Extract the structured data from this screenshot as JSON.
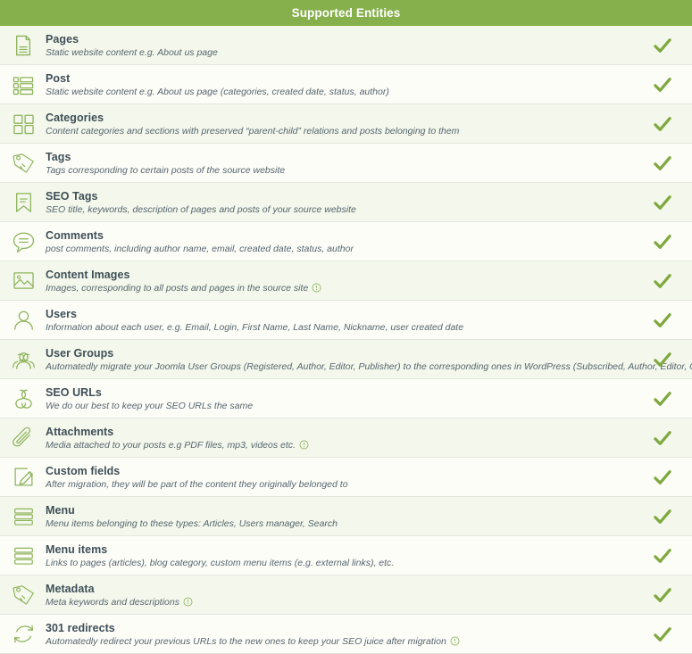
{
  "header": {
    "title": "Supported Entities",
    "bg_color": "#86b04b",
    "text_color": "#ffffff"
  },
  "colors": {
    "accent_green": "#86b04b",
    "icon_green": "#8cb25a",
    "check_green": "#7fa93f",
    "row_alt_bg": "#f4f8ec",
    "row_bg": "#fdfdf8",
    "title_text": "#3e4f57",
    "desc_text": "#55646d",
    "divider": "#e3e6dd"
  },
  "status_icon": "check-mark",
  "rows": [
    {
      "icon": "document-icon",
      "title": "Pages",
      "desc": "Static website content e.g. About us page",
      "info": false,
      "supported": true
    },
    {
      "icon": "post-list-icon",
      "title": "Post",
      "desc": "Static website content e.g. About us page (categories, created date, status, author)",
      "info": false,
      "supported": true
    },
    {
      "icon": "grid-squares-icon",
      "title": "Categories",
      "desc": "Content categories and sections with preserved “parent-child” relations and posts belonging to them",
      "info": false,
      "supported": true
    },
    {
      "icon": "tag-icon",
      "title": "Tags",
      "desc": "Tags corresponding to certain posts of the source website",
      "info": false,
      "supported": true
    },
    {
      "icon": "bookmark-icon",
      "title": "SEO Tags",
      "desc": "SEO title, keywords, description of pages and posts of your source website",
      "info": false,
      "supported": true
    },
    {
      "icon": "speech-bubble-icon",
      "title": "Comments",
      "desc": "post comments, including author name, email, created date, status, author",
      "info": false,
      "supported": true
    },
    {
      "icon": "image-icon",
      "title": "Content Images",
      "desc": "Images, corresponding to all posts and pages in the source site",
      "info": true,
      "supported": true
    },
    {
      "icon": "user-icon",
      "title": "Users",
      "desc": "Information about each user, e.g. Email, Login, First Name, Last Name, Nickname, user created date",
      "info": false,
      "supported": true
    },
    {
      "icon": "users-group-icon",
      "title": "User Groups",
      "desc": "Automatedly migrate your Joomla User Groups (Registered, Author, Editor, Publisher) to the corresponding ones in WordPress (Subscribed, Author, Editor, Contributor)",
      "info": false,
      "supported": true
    },
    {
      "icon": "link-chain-icon",
      "title": "SEO URLs",
      "desc": "We do our best to keep your SEO URLs the same",
      "info": false,
      "supported": true
    },
    {
      "icon": "paperclip-icon",
      "title": "Attachments",
      "desc": "Media attached to your posts e.g PDF files, mp3, videos etc.",
      "info": true,
      "supported": true
    },
    {
      "icon": "edit-pencil-icon",
      "title": "Custom fields",
      "desc": "After migration, they will be part of the content they originally belonged to",
      "info": false,
      "supported": true
    },
    {
      "icon": "menu-stack-icon",
      "title": "Menu",
      "desc": "Menu items belonging to these types: Articles, Users manager, Search",
      "info": false,
      "supported": true
    },
    {
      "icon": "menu-stack-icon",
      "title": "Menu items",
      "desc": "Links to pages (articles), blog category, custom menu items (e.g. external links), etc.",
      "info": false,
      "supported": true
    },
    {
      "icon": "tag-icon",
      "title": "Metadata",
      "desc": "Meta keywords and descriptions",
      "info": true,
      "supported": true
    },
    {
      "icon": "redirect-arrows-icon",
      "title": "301 redirects",
      "desc": "Automatedly redirect your previous URLs to the new ones to keep your SEO juice after migration",
      "info": true,
      "supported": true
    }
  ]
}
